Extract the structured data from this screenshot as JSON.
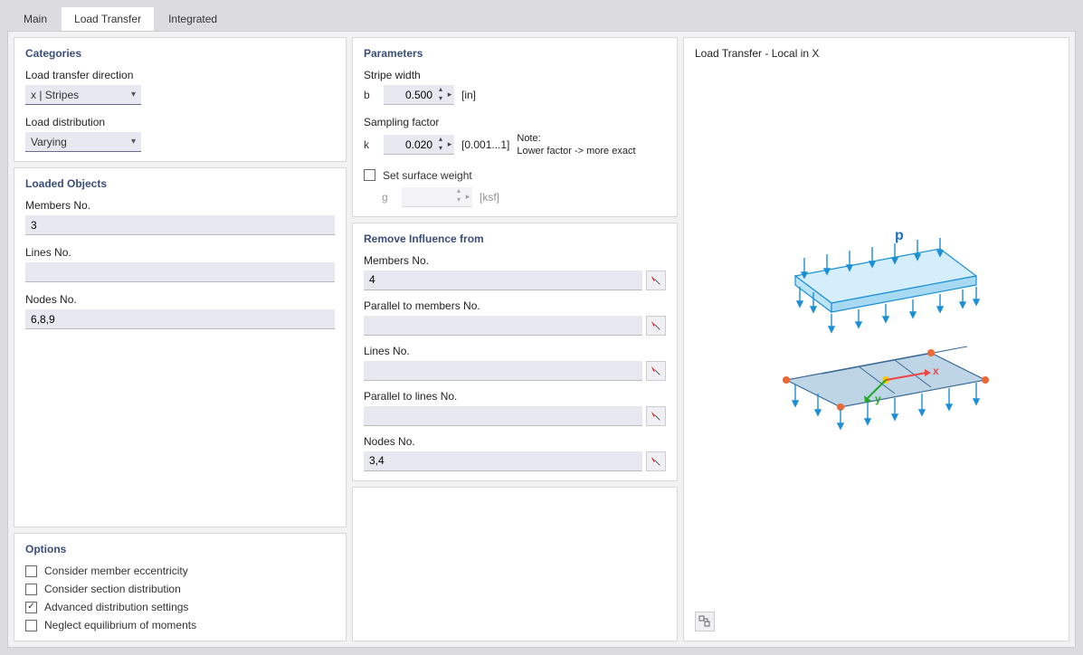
{
  "tabs": {
    "main": "Main",
    "load_transfer": "Load Transfer",
    "integrated": "Integrated"
  },
  "categories": {
    "title": "Categories",
    "direction_label": "Load transfer direction",
    "direction_value": "x | Stripes",
    "distribution_label": "Load distribution",
    "distribution_value": "Varying"
  },
  "loaded_objects": {
    "title": "Loaded Objects",
    "members_label": "Members No.",
    "members_value": "3",
    "lines_label": "Lines No.",
    "lines_value": "",
    "nodes_label": "Nodes No.",
    "nodes_value": "6,8,9"
  },
  "options": {
    "title": "Options",
    "eccentricity": "Consider member eccentricity",
    "section_dist": "Consider section distribution",
    "advanced": "Advanced distribution settings",
    "neglect": "Neglect equilibrium of moments"
  },
  "parameters": {
    "title": "Parameters",
    "stripe_label": "Stripe width",
    "stripe_sym": "b",
    "stripe_value": "0.500",
    "stripe_unit": "[in]",
    "sampling_label": "Sampling factor",
    "sampling_sym": "k",
    "sampling_value": "0.020",
    "sampling_range": "[0.001...1]",
    "note_title": "Note:",
    "note_text": "Lower factor ->  more exact",
    "set_weight": "Set surface weight",
    "g_sym": "g",
    "g_value": "",
    "g_unit": "[ksf]"
  },
  "remove": {
    "title": "Remove Influence from",
    "members_label": "Members No.",
    "members_value": "4",
    "par_members_label": "Parallel to members No.",
    "par_members_value": "",
    "lines_label": "Lines No.",
    "lines_value": "",
    "par_lines_label": "Parallel to lines No.",
    "par_lines_value": "",
    "nodes_label": "Nodes No.",
    "nodes_value": "3,4"
  },
  "preview": {
    "title": "Load Transfer - Local in X",
    "p_label": "p",
    "x_label": "x",
    "y_label": "y"
  }
}
